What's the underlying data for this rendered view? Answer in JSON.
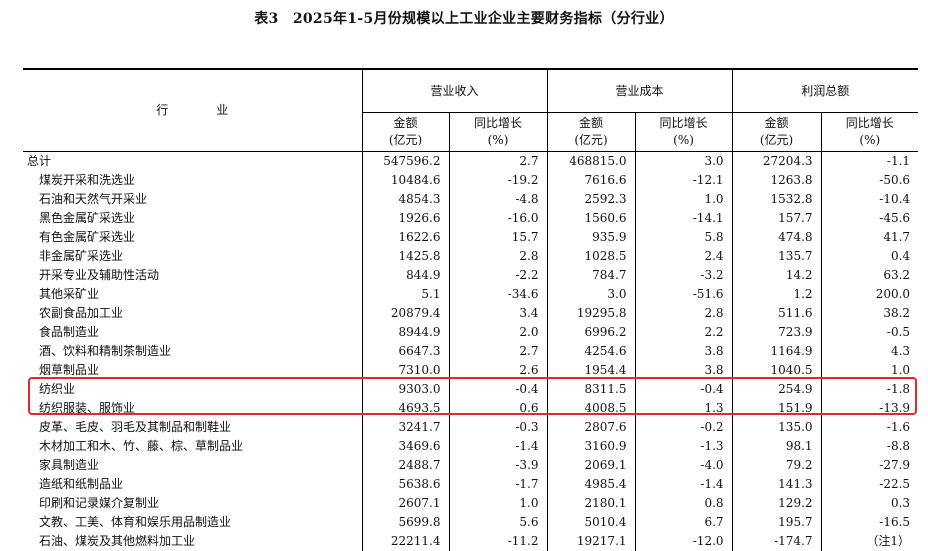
{
  "title": "表3　2025年1-5月份规模以上工业企业主要财务指标（分行业）",
  "header": {
    "industry": "行　业",
    "groups": [
      "营业收入",
      "营业成本",
      "利润总额"
    ],
    "amount": "金额",
    "amount_unit": "(亿元)",
    "growth": "同比增长",
    "growth_unit": "(%)"
  },
  "rows": [
    {
      "name": "总计",
      "rev": "547596.2",
      "rev_g": "2.7",
      "cost": "468815.0",
      "cost_g": "3.0",
      "profit": "27204.3",
      "profit_g": "-1.1"
    },
    {
      "name": "煤炭开采和洗选业",
      "rev": "10484.6",
      "rev_g": "-19.2",
      "cost": "7616.6",
      "cost_g": "-12.1",
      "profit": "1263.8",
      "profit_g": "-50.6"
    },
    {
      "name": "石油和天然气开采业",
      "rev": "4854.3",
      "rev_g": "-4.8",
      "cost": "2592.3",
      "cost_g": "1.0",
      "profit": "1532.8",
      "profit_g": "-10.4"
    },
    {
      "name": "黑色金属矿采选业",
      "rev": "1926.6",
      "rev_g": "-16.0",
      "cost": "1560.6",
      "cost_g": "-14.1",
      "profit": "157.7",
      "profit_g": "-45.6"
    },
    {
      "name": "有色金属矿采选业",
      "rev": "1622.6",
      "rev_g": "15.7",
      "cost": "935.9",
      "cost_g": "5.8",
      "profit": "474.8",
      "profit_g": "41.7"
    },
    {
      "name": "非金属矿采选业",
      "rev": "1425.8",
      "rev_g": "2.8",
      "cost": "1028.5",
      "cost_g": "2.4",
      "profit": "135.7",
      "profit_g": "0.4"
    },
    {
      "name": "开采专业及辅助性活动",
      "rev": "844.9",
      "rev_g": "-2.2",
      "cost": "784.7",
      "cost_g": "-3.2",
      "profit": "14.2",
      "profit_g": "63.2"
    },
    {
      "name": "其他采矿业",
      "rev": "5.1",
      "rev_g": "-34.6",
      "cost": "3.0",
      "cost_g": "-51.6",
      "profit": "1.2",
      "profit_g": "200.0"
    },
    {
      "name": "农副食品加工业",
      "rev": "20879.4",
      "rev_g": "3.4",
      "cost": "19295.8",
      "cost_g": "2.8",
      "profit": "511.6",
      "profit_g": "38.2"
    },
    {
      "name": "食品制造业",
      "rev": "8944.9",
      "rev_g": "2.0",
      "cost": "6996.2",
      "cost_g": "2.2",
      "profit": "723.9",
      "profit_g": "-0.5"
    },
    {
      "name": "酒、饮料和精制茶制造业",
      "rev": "6647.3",
      "rev_g": "2.7",
      "cost": "4254.6",
      "cost_g": "3.8",
      "profit": "1164.9",
      "profit_g": "4.3"
    },
    {
      "name": "烟草制品业",
      "rev": "7310.0",
      "rev_g": "2.6",
      "cost": "1954.4",
      "cost_g": "3.8",
      "profit": "1040.5",
      "profit_g": "1.0"
    },
    {
      "name": "纺织业",
      "rev": "9303.0",
      "rev_g": "-0.4",
      "cost": "8311.5",
      "cost_g": "-0.4",
      "profit": "254.9",
      "profit_g": "-1.8"
    },
    {
      "name": "纺织服装、服饰业",
      "rev": "4693.5",
      "rev_g": "0.6",
      "cost": "4008.5",
      "cost_g": "1.3",
      "profit": "151.9",
      "profit_g": "-13.9"
    },
    {
      "name": "皮革、毛皮、羽毛及其制品和制鞋业",
      "rev": "3241.7",
      "rev_g": "-0.3",
      "cost": "2807.6",
      "cost_g": "-0.2",
      "profit": "135.0",
      "profit_g": "-1.6"
    },
    {
      "name": "木材加工和木、竹、藤、棕、草制品业",
      "rev": "3469.6",
      "rev_g": "-1.4",
      "cost": "3160.9",
      "cost_g": "-1.3",
      "profit": "98.1",
      "profit_g": "-8.8"
    },
    {
      "name": "家具制造业",
      "rev": "2488.7",
      "rev_g": "-3.9",
      "cost": "2069.1",
      "cost_g": "-4.0",
      "profit": "79.2",
      "profit_g": "-27.9"
    },
    {
      "name": "造纸和纸制品业",
      "rev": "5638.6",
      "rev_g": "-1.7",
      "cost": "4985.4",
      "cost_g": "-1.4",
      "profit": "141.3",
      "profit_g": "-22.5"
    },
    {
      "name": "印刷和记录媒介复制业",
      "rev": "2607.1",
      "rev_g": "1.0",
      "cost": "2180.1",
      "cost_g": "0.8",
      "profit": "129.2",
      "profit_g": "0.3"
    },
    {
      "name": "文教、工美、体育和娱乐用品制造业",
      "rev": "5699.8",
      "rev_g": "5.6",
      "cost": "5010.4",
      "cost_g": "6.7",
      "profit": "195.7",
      "profit_g": "-16.5"
    },
    {
      "name": "石油、煤炭及其他燃料加工业",
      "rev": "22211.4",
      "rev_g": "-11.2",
      "cost": "19217.1",
      "cost_g": "-12.0",
      "profit": "-174.7",
      "profit_g": "（注1）"
    }
  ],
  "colors": {
    "highlight": "#e8262d"
  }
}
